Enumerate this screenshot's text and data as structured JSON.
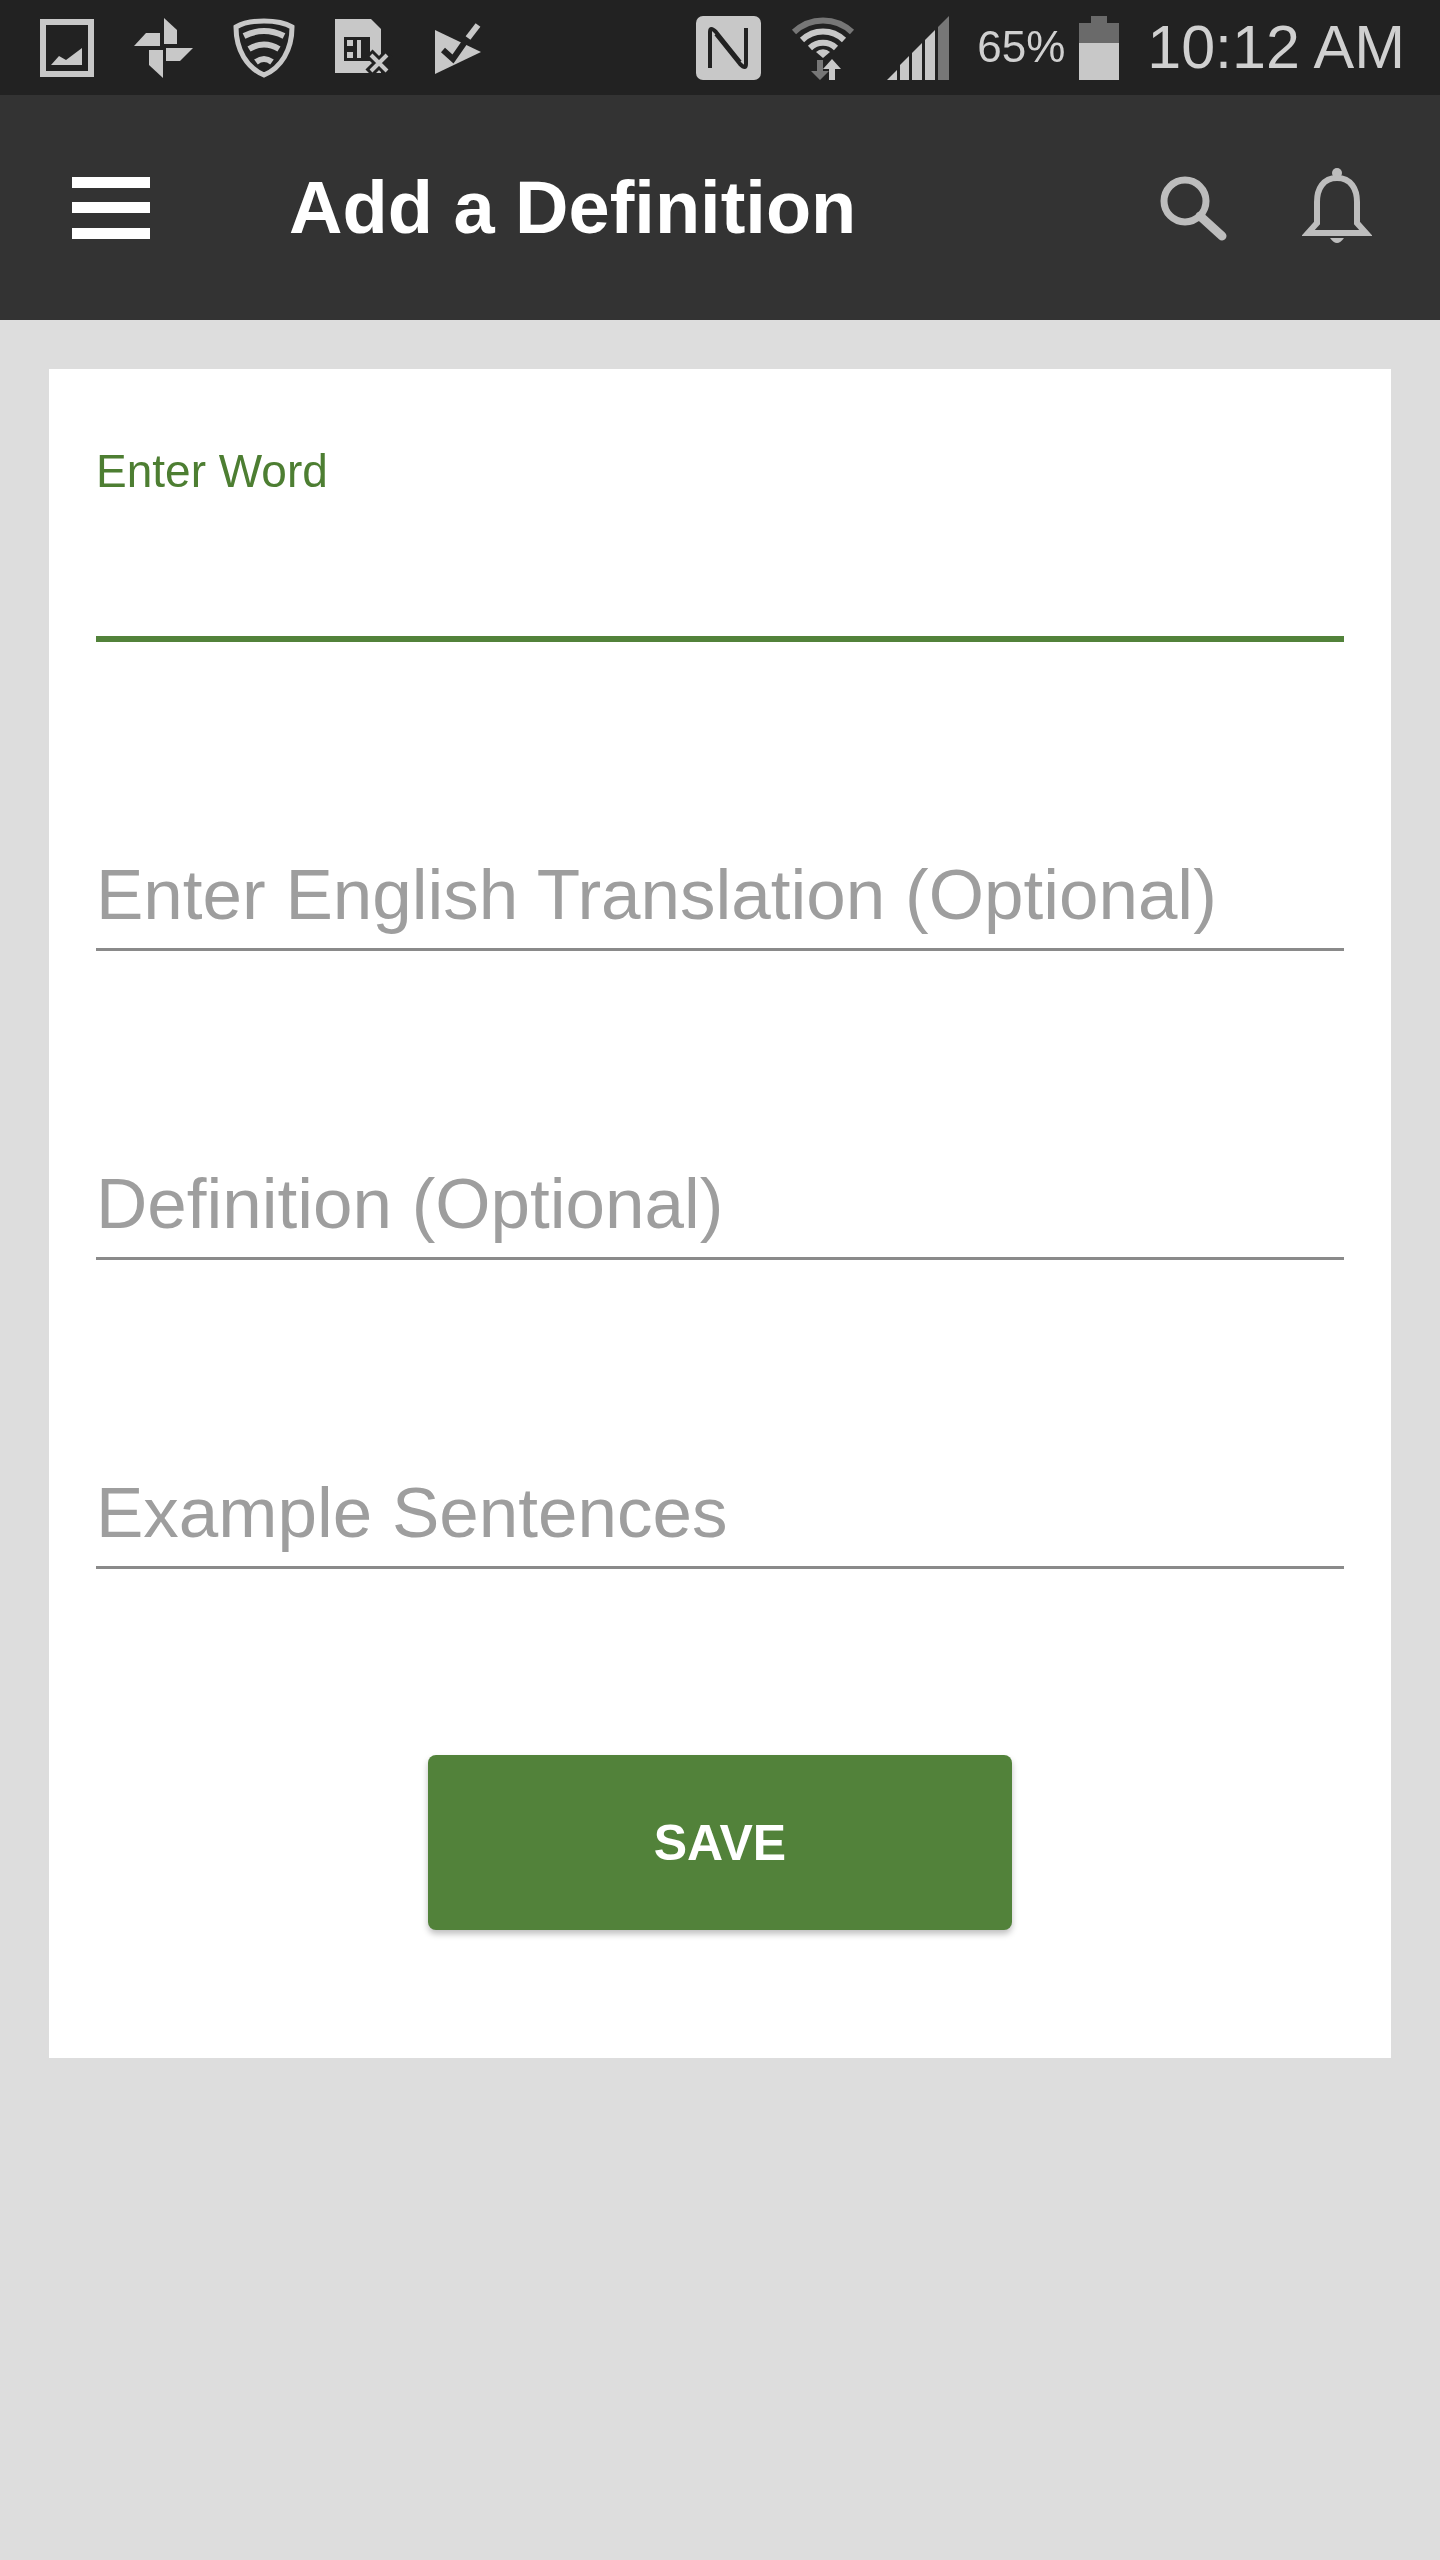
{
  "status_bar": {
    "battery": "65%",
    "time": "10:12 AM"
  },
  "app_bar": {
    "title": "Add a Definition"
  },
  "form": {
    "fields": [
      {
        "label": "Enter Word",
        "focused": true
      },
      {
        "placeholder": "Enter English Translation (Optional)",
        "focused": false
      },
      {
        "placeholder": "Definition (Optional)",
        "focused": false
      },
      {
        "placeholder": "Example Sentences",
        "focused": false
      }
    ],
    "save_button": "SAVE"
  }
}
